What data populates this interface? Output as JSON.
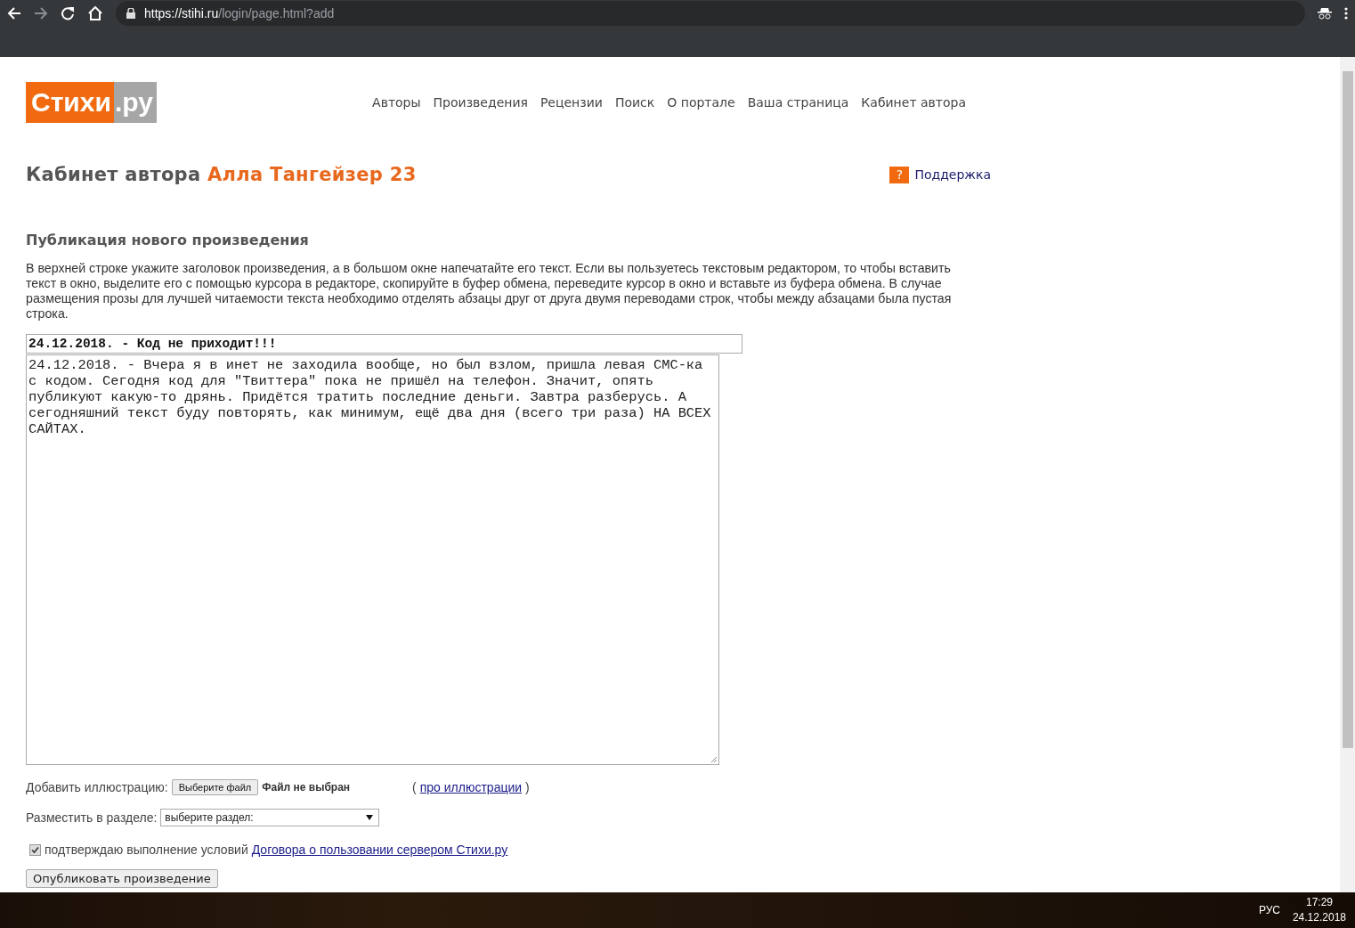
{
  "browser": {
    "address_host": "https://stihi.ru",
    "address_path": "/login/page.html?add"
  },
  "header": {
    "logo_main": "Стихи",
    "logo_suffix": ".ру",
    "nav": [
      {
        "label": "Авторы"
      },
      {
        "label": "Произведения"
      },
      {
        "label": "Рецензии"
      },
      {
        "label": "Поиск"
      },
      {
        "label": "О портале"
      },
      {
        "label": "Ваша страница"
      },
      {
        "label": "Кабинет автора"
      }
    ]
  },
  "cabinet": {
    "title": "Кабинет автора",
    "author": "Алла Тангейзер 23",
    "support_icon": "?",
    "support_link": "Поддержка"
  },
  "form": {
    "heading": "Публикация нового произведения",
    "instructions": "В верхней строке укажите заголовок произведения, а в большом окне напечатайте его текст. Если вы пользуетесь текстовым редактором, то чтобы вставить текст в окно, выделите его с помощью курсора в редакторе, скопируйте в буфер обмена, переведите курсор в окно и вставьте из буфера обмена. В случае размещения прозы для лучшей читаемости текста необходимо отделять абзацы друг от друга двумя переводами строк, чтобы между абзацами была пустая строка.",
    "title_value": "24.12.2018. - Код не приходит!!!",
    "body_value": "24.12.2018. - Вчера я в инет не заходила вообще, но был взлом, пришла левая СМС-ка с кодом. Сегодня код для \"Твиттера\" пока не пришёл на телефон. Значит, опять публикуют какую-то дрянь. Придётся тратить последние деньги. Завтра разберусь. А сегодняшний текст буду повторять, как минимум, ещё два дня (всего три раза) НА ВСЕХ САЙТАХ.",
    "illustration_label": "Добавить иллюстрацию:",
    "file_button": "Выберите файл",
    "file_status": "Файл не выбран",
    "about_open": "(",
    "about_link": "про иллюстрации",
    "about_close": ")",
    "section_label": "Разместить в разделе:",
    "section_value": "выберите раздел:",
    "agree_checked": true,
    "agree_text": "подтверждаю выполнение условий",
    "agree_link": "Договора о пользовании сервером Стихи.ру",
    "submit": "Опубликовать произведение"
  },
  "taskbar": {
    "language": "РУС",
    "time": "17:29",
    "date": "24.12.2018"
  }
}
